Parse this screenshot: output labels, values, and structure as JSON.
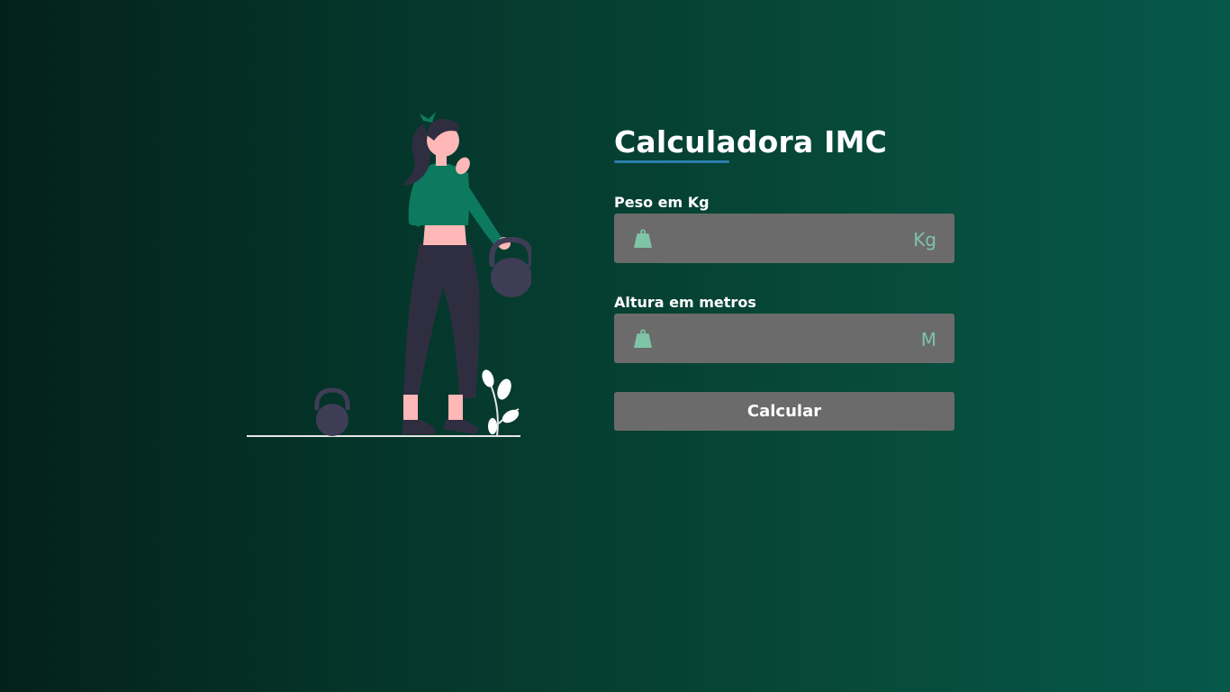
{
  "header": {
    "title": "Calculadora IMC"
  },
  "form": {
    "weight": {
      "label": "Peso em Kg",
      "unit": "Kg",
      "value": "",
      "icon": "weight-icon"
    },
    "height": {
      "label": "Altura em metros",
      "unit": "M",
      "value": "",
      "icon": "weight-icon"
    },
    "submit_label": "Calcular"
  },
  "colors": {
    "accent_underline": "#2a7fa8",
    "input_bg": "#6b6b6b",
    "unit_text": "#7fc4a7",
    "shirt": "#0d7a5f"
  }
}
